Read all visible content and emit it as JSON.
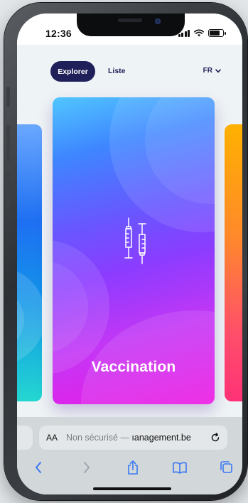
{
  "status_bar": {
    "time": "12:36"
  },
  "nav": {
    "tabs": [
      {
        "label": "Explorer",
        "active": true
      },
      {
        "label": "Liste",
        "active": false
      }
    ],
    "language": "FR"
  },
  "cards": {
    "main": {
      "title": "Vaccination",
      "icon": "syringes-icon"
    }
  },
  "browser": {
    "aa_label": "AA",
    "insecure_text": "Non sécurisé — ",
    "domain_text": "ıanagement.be"
  },
  "colors": {
    "accent": "#1f1f5a",
    "card_top": "#51c6ff",
    "card_bottom": "#ee18e3"
  }
}
